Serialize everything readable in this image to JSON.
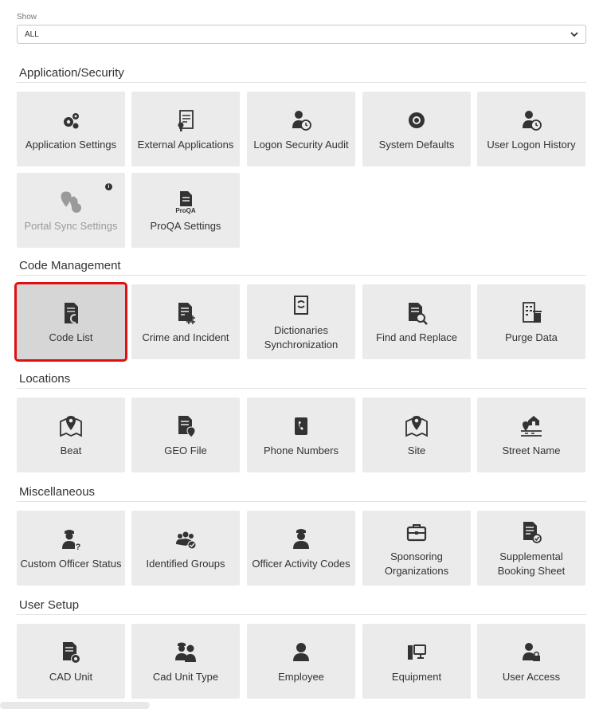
{
  "filter": {
    "label": "Show",
    "value": "ALL"
  },
  "sections": [
    {
      "title": "Application/Security",
      "tiles": [
        {
          "label": "Application Settings",
          "icon": "gears-icon"
        },
        {
          "label": "External Applications",
          "icon": "document-key-icon"
        },
        {
          "label": "Logon Security Audit",
          "icon": "user-clock-icon"
        },
        {
          "label": "System Defaults",
          "icon": "gear-icon"
        },
        {
          "label": "User Logon History",
          "icon": "user-clock-icon"
        },
        {
          "label": "Portal Sync Settings",
          "icon": "map-sync-icon",
          "disabled": true
        },
        {
          "label": "ProQA Settings",
          "icon": "proqa-document-icon"
        }
      ]
    },
    {
      "title": "Code Management",
      "tiles": [
        {
          "label": "Code List",
          "icon": "code-list-icon",
          "selected": true
        },
        {
          "label": "Crime and Incident",
          "icon": "document-hash-icon"
        },
        {
          "label": "Dictionaries Synchronization",
          "icon": "book-sync-icon"
        },
        {
          "label": "Find and Replace",
          "icon": "document-search-icon"
        },
        {
          "label": "Purge Data",
          "icon": "building-trash-icon"
        }
      ]
    },
    {
      "title": "Locations",
      "tiles": [
        {
          "label": "Beat",
          "icon": "map-pin-icon"
        },
        {
          "label": "GEO File",
          "icon": "document-pin-icon"
        },
        {
          "label": "Phone Numbers",
          "icon": "phone-book-icon"
        },
        {
          "label": "Site",
          "icon": "map-pin-icon"
        },
        {
          "label": "Street Name",
          "icon": "street-house-icon"
        }
      ]
    },
    {
      "title": "Miscellaneous",
      "tiles": [
        {
          "label": "Custom Officer Status",
          "icon": "officer-question-icon"
        },
        {
          "label": "Identified Groups",
          "icon": "group-check-icon"
        },
        {
          "label": "Officer Activity Codes",
          "icon": "officer-icon"
        },
        {
          "label": "Sponsoring Organizations",
          "icon": "briefcase-icon"
        },
        {
          "label": "Supplemental Booking Sheet",
          "icon": "document-check-icon"
        }
      ]
    },
    {
      "title": "User Setup",
      "tiles": [
        {
          "label": "CAD Unit",
          "icon": "document-gear-icon"
        },
        {
          "label": "Cad Unit Type",
          "icon": "officers-icon"
        },
        {
          "label": "Employee",
          "icon": "user-icon"
        },
        {
          "label": "Equipment",
          "icon": "computer-icon"
        },
        {
          "label": "User Access",
          "icon": "user-lock-icon"
        }
      ]
    }
  ],
  "colors": {
    "tile": "#ebebeb",
    "selected_outline": "#e01010",
    "icon": "#333333"
  }
}
